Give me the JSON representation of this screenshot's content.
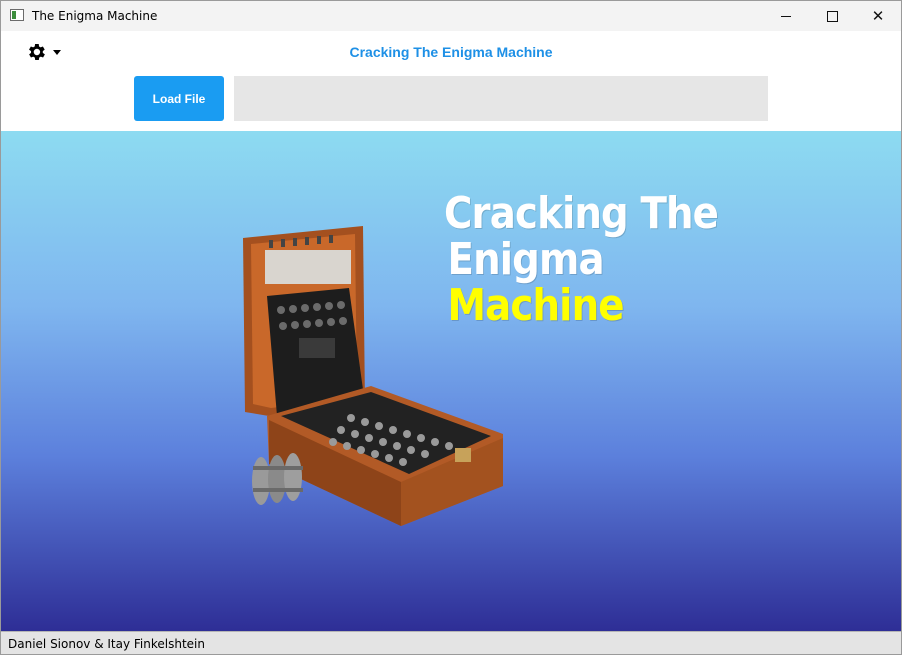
{
  "window": {
    "title": "The Enigma Machine",
    "controls": {
      "minimize": "minimize-icon",
      "maximize": "maximize-icon",
      "close": "close-icon"
    }
  },
  "header": {
    "title": "Cracking The Enigma Machine",
    "settings_icon": "gear-icon",
    "load_button_label": "Load File",
    "file_path_value": ""
  },
  "hero": {
    "title_line1": "Cracking The",
    "title_line2": "Enigma",
    "title_line3": "Machine",
    "colors": {
      "title": "#ffffff",
      "highlight": "#ffff00",
      "gradient_top": "#8ddbf1",
      "gradient_bottom": "#2e2e96"
    },
    "image": "enigma-machine-illustration"
  },
  "status": {
    "text": "Daniel Sionov & Itay Finkelshtein"
  },
  "accent_color": "#1a9cf2"
}
